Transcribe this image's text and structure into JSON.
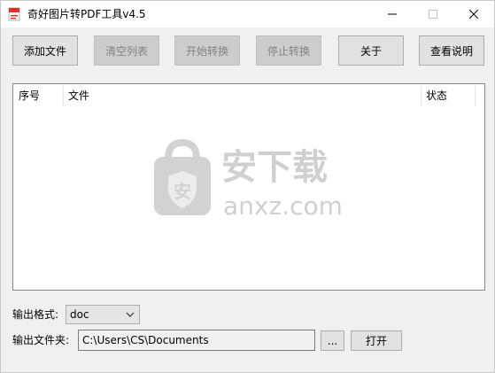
{
  "window": {
    "title": "奇好图片转PDF工具v4.5"
  },
  "toolbar": {
    "add_file": "添加文件",
    "clear_list": "清空列表",
    "start_convert": "开始转换",
    "stop_convert": "停止转换",
    "about": "关于",
    "help": "查看说明"
  },
  "list": {
    "columns": [
      "序号",
      "文件",
      "状态"
    ],
    "rows": []
  },
  "watermark": {
    "cn": "安下载",
    "en": "anxz.com"
  },
  "output": {
    "format_label": "输出格式:",
    "format_value": "doc",
    "folder_label": "输出文件夹:",
    "folder_value": "C:\\Users\\CS\\Documents",
    "browse_label": "...",
    "open_label": "打开"
  },
  "colors": {
    "titlebar_bg": "#ffffff",
    "window_bg": "#f0f0f0",
    "button_bg": "#e1e1e1",
    "button_disabled_bg": "#cccccc",
    "watermark": "#d0d0d0"
  }
}
